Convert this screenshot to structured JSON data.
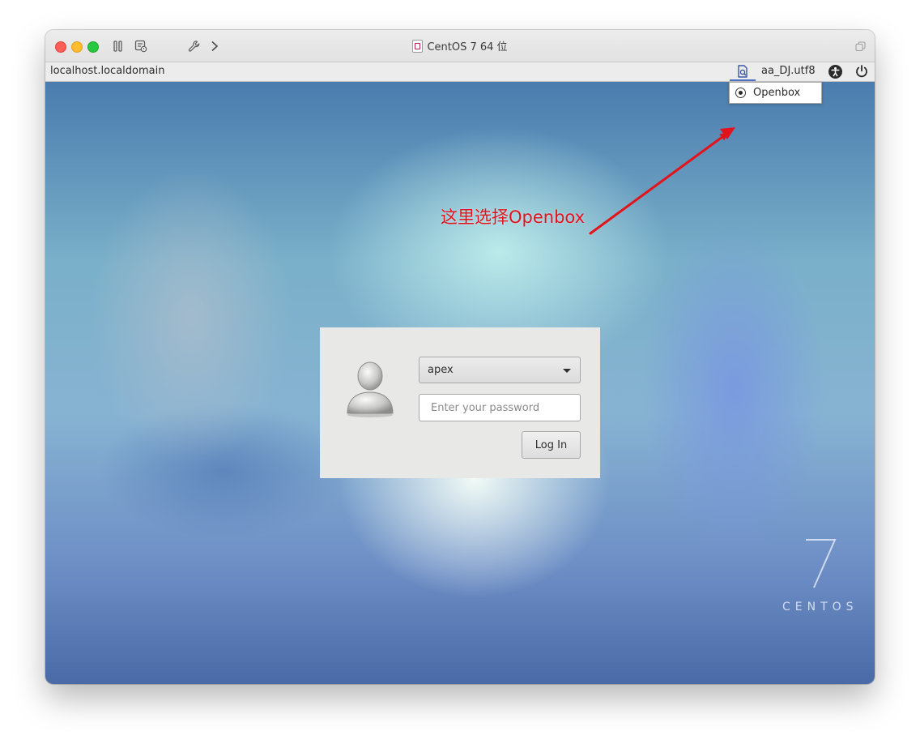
{
  "window": {
    "title": "CentOS 7 64 位"
  },
  "vm_bar": {
    "hostname": "localhost.localdomain",
    "keyboard_layout": "aa_DJ.utf8"
  },
  "session_menu": {
    "selected": "Openbox"
  },
  "annotation": {
    "text": "这里选择Openbox",
    "color": "#e3131c"
  },
  "login": {
    "username": "apex",
    "password_placeholder": "Enter your password",
    "login_button": "Log In"
  },
  "branding": {
    "version": "7",
    "name": "CENTOS"
  },
  "colors": {
    "accent": "#4a6fc2",
    "close": "#fe5f57",
    "minimize": "#febc2e",
    "maximize": "#28c840"
  }
}
